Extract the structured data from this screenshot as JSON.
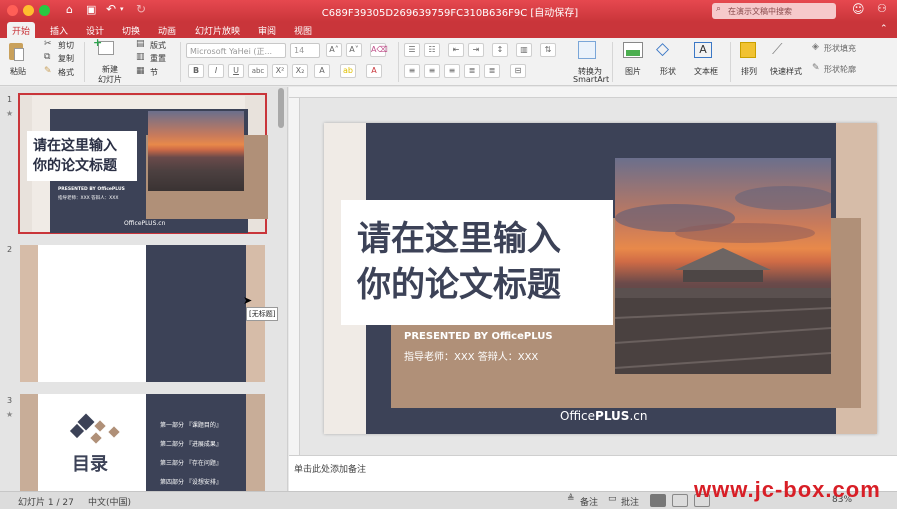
{
  "window": {
    "title": "C689F39305D269639759FC310B636F9C [自动保存]",
    "search_placeholder": "在演示文稿中搜索"
  },
  "tabs": [
    "开始",
    "插入",
    "设计",
    "切换",
    "动画",
    "幻灯片放映",
    "审阅",
    "视图"
  ],
  "ribbon": {
    "paste": "粘贴",
    "cut": "剪切",
    "copy": "复制",
    "format": "格式",
    "new_slide_line1": "新建",
    "new_slide_line2": "幻灯片",
    "layout": "版式",
    "reset": "重置",
    "section": "节",
    "font_name": "Microsoft YaHei (正...",
    "font_size": "14",
    "convert_smartart_line1": "转换为",
    "convert_smartart_line2": "SmartArt",
    "picture": "图片",
    "shape": "形状",
    "textbox": "文本框",
    "arrange": "排列",
    "quick_styles": "快速样式",
    "shape_fill": "形状填充",
    "shape_outline": "形状轮廓",
    "buttons_bold": "B",
    "buttons_italic": "I",
    "buttons_underline": "U",
    "buttons_strike": "abc",
    "buttons_sup": "X²",
    "buttons_sub": "X₂"
  },
  "thumbnails": {
    "slide1": {
      "num": "1",
      "title_line1": "请在这里输入",
      "title_line2": "你的论文标题",
      "presented": "PRESENTED BY OfficePLUS",
      "teacher": "指导老师：XXX  答辩人：XXX",
      "footer": "OfficePLUS.cn"
    },
    "slide2": {
      "num": "2",
      "tooltip": "[无标题]"
    },
    "slide3": {
      "num": "3",
      "title": "目录",
      "items": [
        "第一部分 『课题目的』",
        "第二部分 『进展成果』",
        "第三部分 『存在问题』",
        "第四部分 『设想安排』"
      ]
    },
    "star": "★"
  },
  "slide": {
    "title_line1": "请在这里输入",
    "title_line2": "你的论文标题",
    "presented": "PRESENTED BY OfficePLUS",
    "teacher": "指导老师：XXX  答辩人：XXX",
    "footer_prefix": "Office",
    "footer_bold": "PLUS",
    "footer_suffix": ".cn"
  },
  "notes_placeholder": "单击此处添加备注",
  "status": {
    "slide_count": "幻灯片 1 / 27",
    "language": "中文(中国)",
    "notes_btn": "备注",
    "comments_btn": "批注",
    "zoom": "83%"
  },
  "watermark": "www.jc-box.com",
  "colors": {
    "accent_red": "#c9353a",
    "slide_navy": "#3c4257",
    "slide_tan": "#b09078"
  }
}
